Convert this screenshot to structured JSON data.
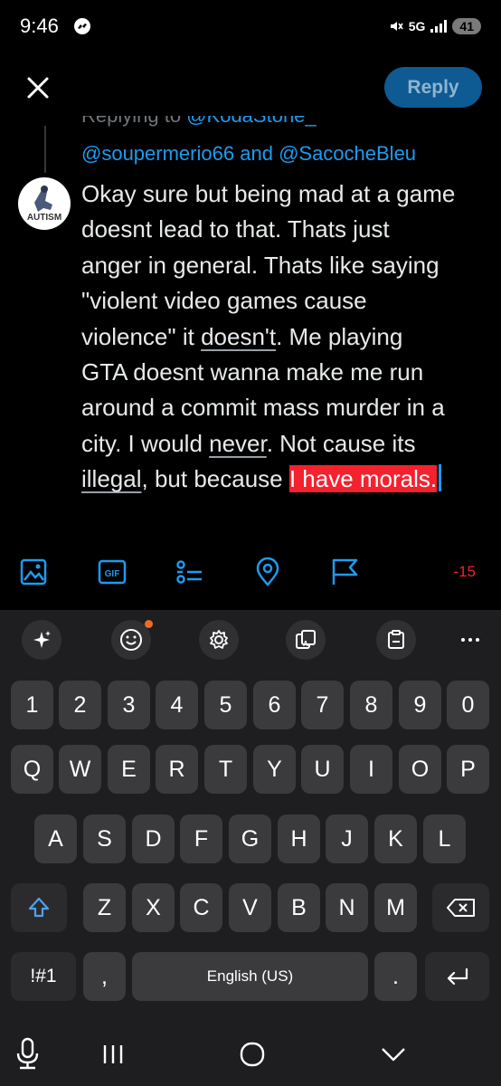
{
  "status_bar": {
    "time": "9:46",
    "network": "5G",
    "battery": "41"
  },
  "header": {
    "reply_label": "Reply"
  },
  "thread": {
    "replying_prefix": "Replying to",
    "replying_handle": "@KodaStone_",
    "handle_1": "@soupermerio66",
    "and_word": "and",
    "handle_2": "@SacocheBleu"
  },
  "avatar": {
    "text": "AUTISM"
  },
  "compose": {
    "line_1": "Okay sure but being mad at a game",
    "line_2": "doesnt lead to that. Thats just",
    "line_3": "anger in general. Thats like saying",
    "line_4": "\"violent video games cause",
    "line_5_a": "violence\" it ",
    "line_5_u": "doesn't",
    "line_5_b": ". Me playing",
    "line_6": "GTA doesnt wanna make me run",
    "line_7": "around a commit mass murder in a",
    "line_8_a": "city. I would ",
    "line_8_u": "never",
    "line_8_b": ". Not cause its",
    "line_9_u": "illegal",
    "line_9_b": ", but because ",
    "line_9_sel": "I have morals."
  },
  "toolbar": {
    "char_counter": "-15"
  },
  "keyboard": {
    "numbers": [
      "1",
      "2",
      "3",
      "4",
      "5",
      "6",
      "7",
      "8",
      "9",
      "0"
    ],
    "row_q": [
      "Q",
      "W",
      "E",
      "R",
      "T",
      "Y",
      "U",
      "I",
      "O",
      "P"
    ],
    "row_a": [
      "A",
      "S",
      "D",
      "F",
      "G",
      "H",
      "J",
      "K",
      "L"
    ],
    "row_z": [
      "Z",
      "X",
      "C",
      "V",
      "B",
      "N",
      "M"
    ],
    "symbols_label": "!#1",
    "comma_label": ",",
    "space_label": "English (US)",
    "period_label": "."
  }
}
